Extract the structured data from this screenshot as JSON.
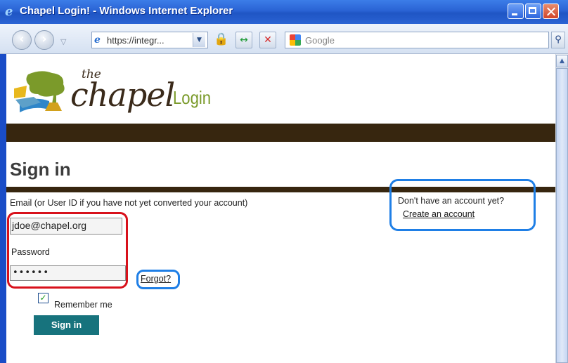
{
  "window": {
    "title": "Chapel Login! - Windows Internet Explorer"
  },
  "toolbar": {
    "address": "https://integr...",
    "search_placeholder": "Google",
    "back_glyph": "‹",
    "forward_glyph": "›",
    "dropdown_glyph": "▽",
    "address_dropdown_glyph": "▼",
    "lock_glyph": "🔒",
    "refresh_glyph": "↔",
    "stop_glyph": "✕",
    "search_glyph": "⚲"
  },
  "logo": {
    "the": "the",
    "chapel": "chapel",
    "login": "Login"
  },
  "form": {
    "heading": "Sign in",
    "email_label": "Email (or User ID if you have not yet converted your account)",
    "email_value": "jdoe@chapel.org",
    "password_label": "Password",
    "password_value": "••••••",
    "forgot_label": "Forgot?",
    "remember_label": "Remember me",
    "remember_checked": true,
    "submit_label": "Sign in"
  },
  "account": {
    "question": "Don't have an account yet?",
    "create_link": "Create an account"
  },
  "colors": {
    "brand_brown": "#37260f",
    "button_teal": "#17737d",
    "annotation_red": "#d8111b",
    "annotation_blue": "#1f7fe6",
    "titlebar_blue": "#2a63d4"
  },
  "icons": {
    "browser": "ie-logo-icon",
    "lock": "lock-icon",
    "search_engine": "google-icon"
  }
}
